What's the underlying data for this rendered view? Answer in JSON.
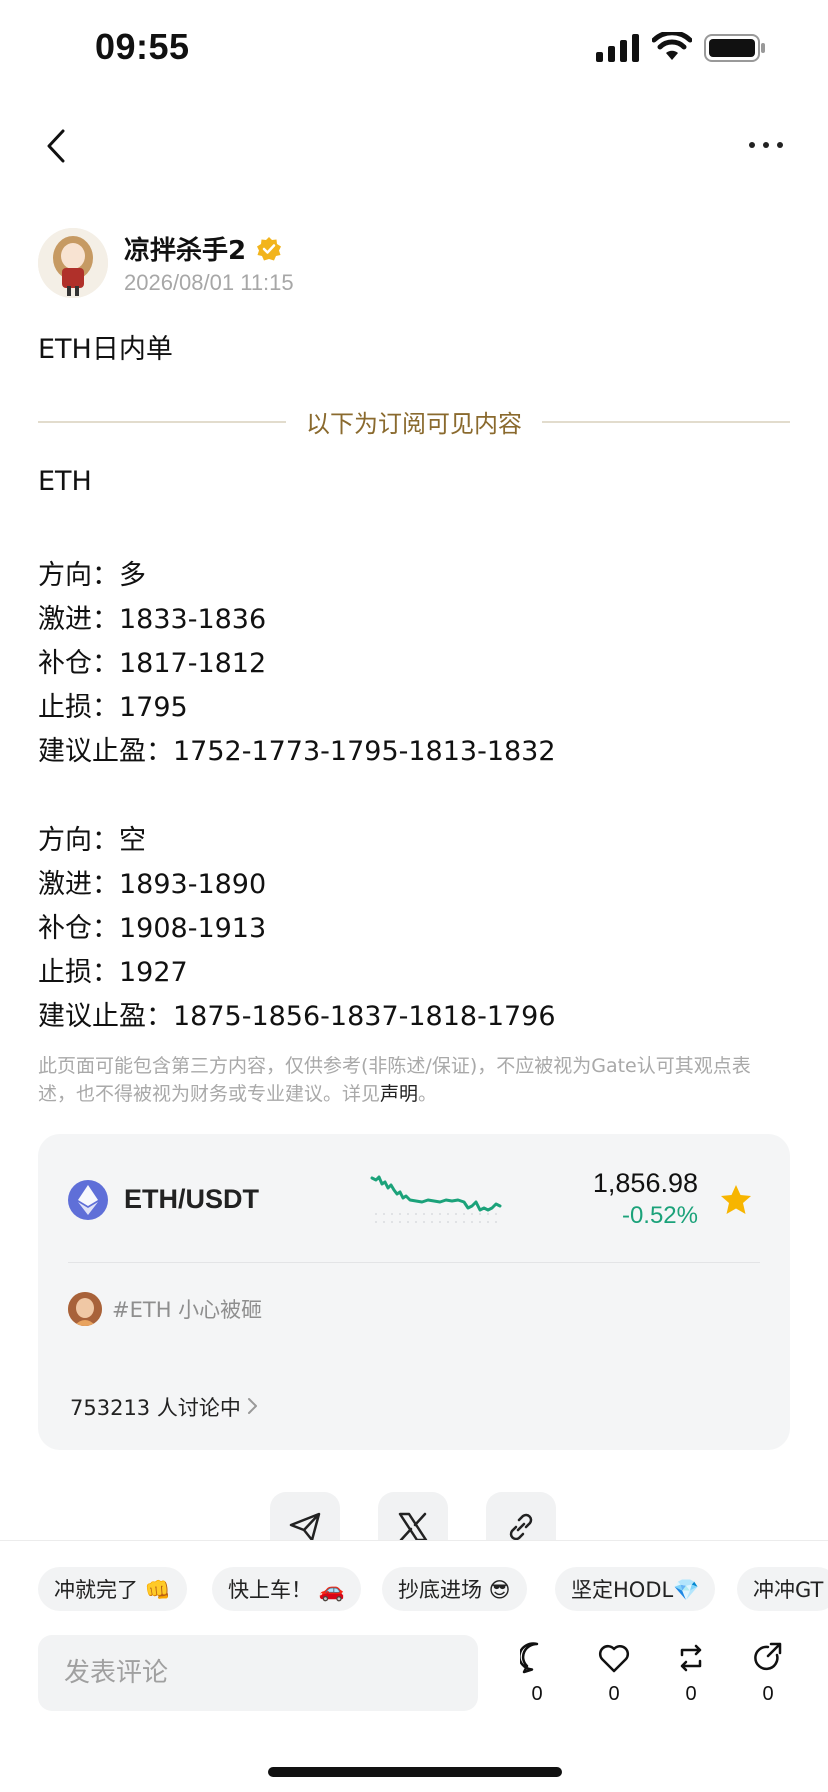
{
  "status_bar": {
    "time": "09:55"
  },
  "author": {
    "name": "凉拌杀手2",
    "timestamp": "2026/08/01 11:15"
  },
  "post": {
    "title": "ETH日内单",
    "subscriber_label": "以下为订阅可见内容",
    "body_lines": [
      "ETH",
      "方向：多",
      "激进：1833-1836",
      "补仓：1817-1812",
      "止损：1795",
      "建议止盈：1752-1773-1795-1813-1832",
      "方向：空",
      "激进：1893-1890",
      "补仓：1908-1913",
      "止损：1927",
      "建议止盈：1875-1856-1837-1818-1796"
    ],
    "disclaimer_text": "此页面可能包含第三方内容，仅供参考(非陈述/保证)，不应被视为Gate认可其观点表述，也不得被视为财务或专业建议。详见",
    "disclaimer_link": "声明",
    "disclaimer_end": "。"
  },
  "market_card": {
    "pair": "ETH/USDT",
    "price": "1,856.98",
    "change": "-0.52%",
    "topic": "#ETH 小心被砸",
    "discussion": "753213 人讨论中",
    "accent_color": "#1ba27a",
    "star_color": "#f7b500"
  },
  "quick_replies": [
    "冲就完了 👊",
    "快上车！ 🚗",
    "抄底进场 😎",
    "坚定HODL💎",
    "冲冲GT"
  ],
  "comment": {
    "placeholder": "发表评论"
  },
  "actions": {
    "comments": "0",
    "likes": "0",
    "reposts": "0",
    "shares": "0"
  }
}
